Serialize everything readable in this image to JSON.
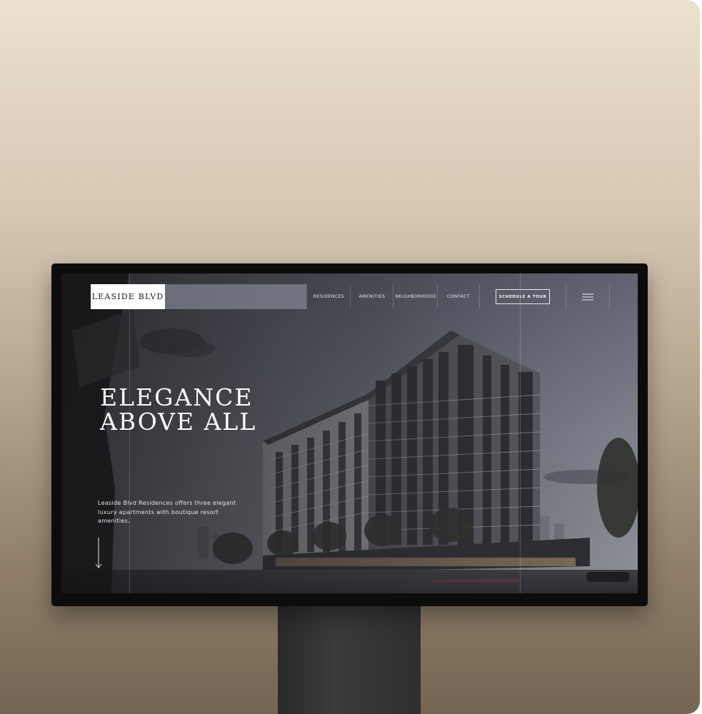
{
  "site": {
    "logo": "LEASIDE BLVD",
    "nav": [
      {
        "label": "RESIDENCES"
      },
      {
        "label": "AMENITIES"
      },
      {
        "label": "NEIGHBORHOOD"
      },
      {
        "label": "CONTACT"
      }
    ],
    "cta_label": "SCHEDULE A TOUR",
    "menu_icon": "hamburger-menu-icon"
  },
  "hero": {
    "title_line1": "ELEGANCE",
    "title_line2": "ABOVE ALL",
    "description": "Leaside Blvd Residences offers three elegant luxury apartments with boutique resort amenities.",
    "scroll_icon": "down-arrow-icon"
  },
  "colors": {
    "background_top": "#ece1cf",
    "background_bottom": "#736552",
    "monitor_bezel": "#0c0c0d",
    "logo_bg": "#ffffff",
    "text_light": "#ffffff"
  }
}
